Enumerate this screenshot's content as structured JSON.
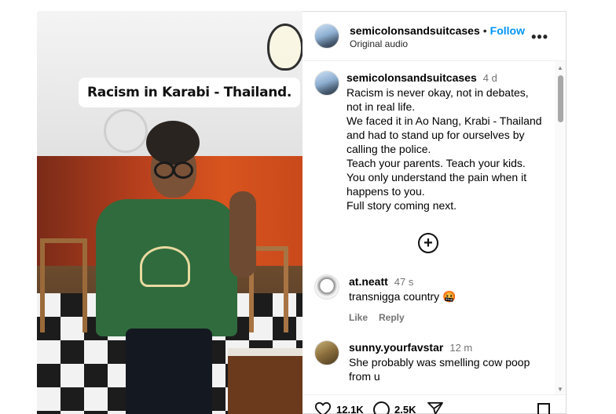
{
  "video": {
    "caption_overlay": "Racism in Karabi - Thailand."
  },
  "header": {
    "username": "semicolonsandsuitcases",
    "separator": "•",
    "follow_label": "Follow",
    "subtitle": "Original audio",
    "more_icon": "more-horizontal-icon"
  },
  "post_caption": {
    "username": "semicolonsandsuitcases",
    "time": "4 d",
    "lines": [
      "Racism is never okay, not in debates,",
      "not in real life.",
      "We faced it in Ao Nang, Krabi - Thailand",
      "and had to stand up for ourselves by",
      "calling the police.",
      "Teach your parents. Teach your kids.",
      "You only understand the pain when it",
      "happens to you.",
      "Full story coming next."
    ]
  },
  "load_more_icon": "plus-circle-icon",
  "comments": [
    {
      "username": "at.neatt",
      "time": "47 s",
      "text": "transnigga country 🤬",
      "like_label": "Like",
      "reply_label": "Reply"
    },
    {
      "username": "sunny.yourfavstar",
      "time": "12 m",
      "text_lines": [
        "She probably was smelling cow poop",
        "from u"
      ]
    }
  ],
  "footer": {
    "likes": "12.1K",
    "comments": "2.5K"
  },
  "colors": {
    "accent": "#0095f6",
    "muted": "#737373",
    "border": "#dbdbdb"
  }
}
